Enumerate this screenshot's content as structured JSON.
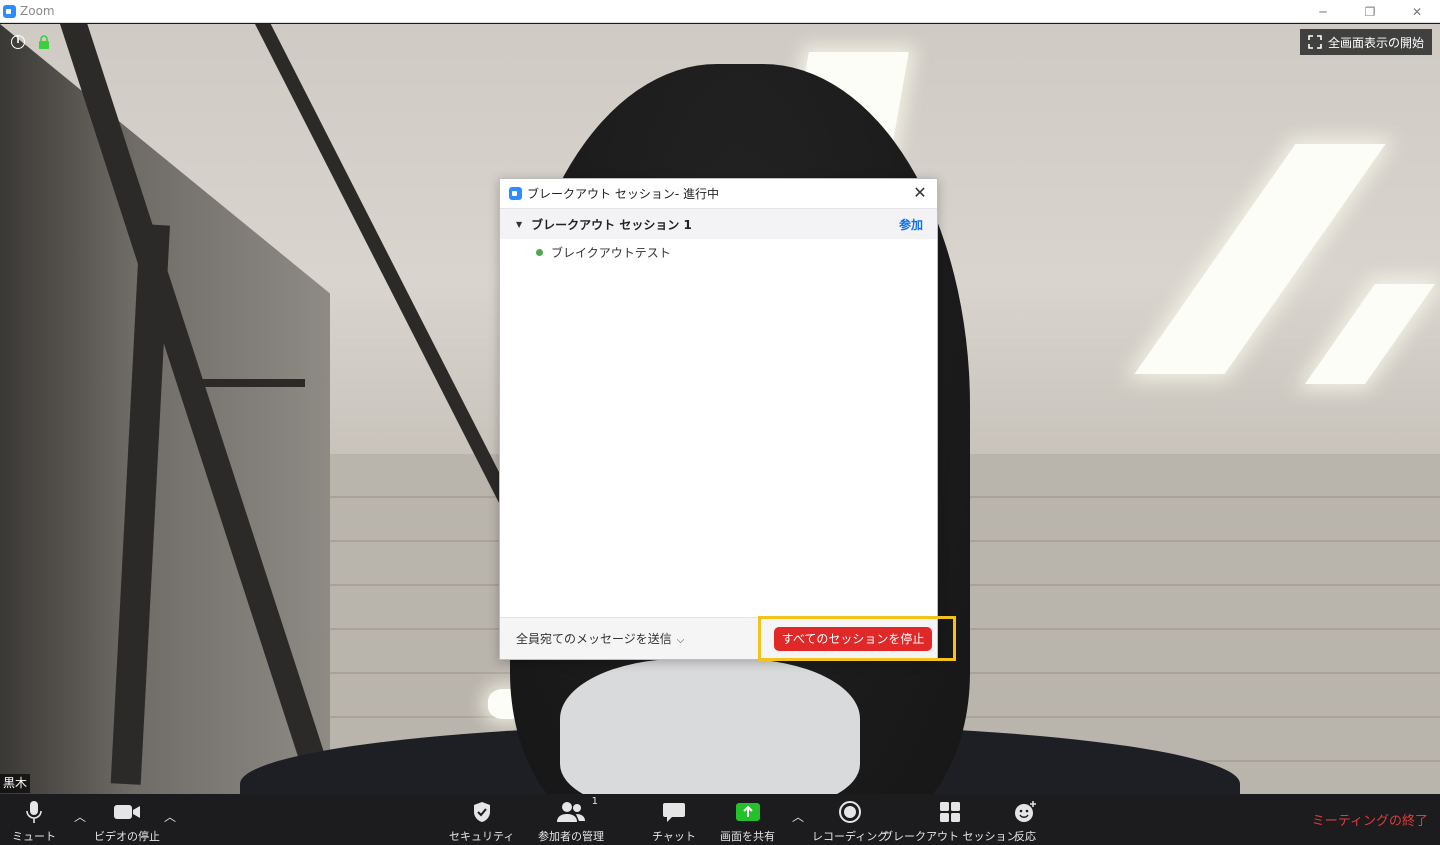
{
  "window": {
    "title": "Zoom",
    "controls": [
      "─",
      "❐",
      "✕"
    ]
  },
  "overlay": {
    "info_icon": "i",
    "fullscreen_label": "全画面表示の開始",
    "participant_name": "黒木"
  },
  "dialog": {
    "title": "ブレークアウト セッション- 進行中",
    "close": "✕",
    "session": {
      "name": "ブレークアウト セッション 1",
      "join_label": "参加"
    },
    "members": [
      {
        "name": "ブレイクアウトテスト",
        "status_color": "#4ea84e"
      }
    ],
    "broadcast_label": "全員宛てのメッセージを送信",
    "stop_all_label": "すべてのセッションを停止"
  },
  "toolbar": {
    "mute_label": "ミュート",
    "video_label": "ビデオの停止",
    "security_label": "セキュリティ",
    "participants_label": "参加者の管理",
    "participants_count": "1",
    "chat_label": "チャット",
    "share_label": "画面を共有",
    "record_label": "レコーディング",
    "breakout_label": "ブレークアウト セッション",
    "reactions_label": "反応",
    "end_label": "ミーティングの終了"
  },
  "colors": {
    "accent": "#2d8cff",
    "danger": "#e02828",
    "highlight": "#f3c21b",
    "share_green": "#23c12a"
  }
}
